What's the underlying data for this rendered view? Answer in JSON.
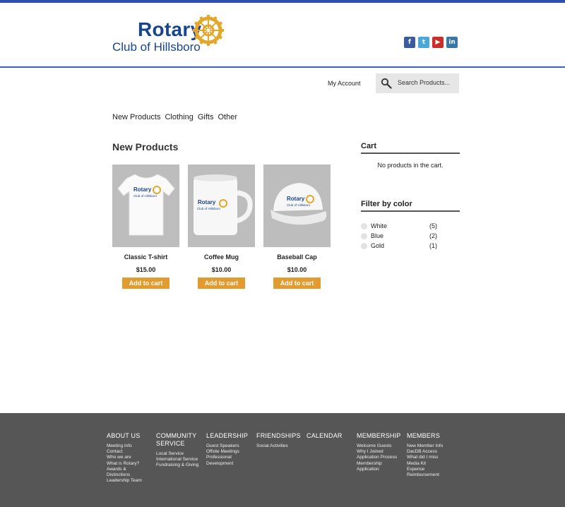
{
  "brand": {
    "logo_title": "Rotary",
    "logo_subtitle": "Club of Hillsboro",
    "wheel_color": "#e3a82b",
    "text_color": "#17458f"
  },
  "social": [
    {
      "name": "facebook",
      "glyph": "f"
    },
    {
      "name": "twitter",
      "glyph": "t"
    },
    {
      "name": "youtube",
      "glyph": "▶"
    },
    {
      "name": "linkedin",
      "glyph": "in"
    }
  ],
  "header": {
    "account_label": "My Account",
    "search_placeholder": "Search Products..."
  },
  "nav": [
    "New Products",
    "Clothing",
    "Gifts",
    "Other"
  ],
  "main": {
    "section_title": "New Products",
    "products": [
      {
        "name": "Classic T-shirt",
        "price": "$15.00",
        "button": "Add to cart",
        "image_text": "Rotary",
        "image_sub": "Club of Hillsboro"
      },
      {
        "name": "Coffee Mug",
        "price": "$10.00",
        "button": "Add to cart",
        "image_text": "Rotary",
        "image_sub": "Club of Hillsboro"
      },
      {
        "name": "Baseball Cap",
        "price": "$10.00",
        "button": "Add to cart",
        "image_text": "Rotary",
        "image_sub": "Club of Hillsboro"
      }
    ]
  },
  "sidebar": {
    "cart_title": "Cart",
    "cart_empty": "No products in the cart.",
    "filter_title": "Filter by color",
    "filters": [
      {
        "label": "White",
        "count": "(5)"
      },
      {
        "label": "Blue",
        "count": "(2)"
      },
      {
        "label": "Gold",
        "count": "(1)"
      }
    ]
  },
  "footer": {
    "columns": [
      {
        "title": "ABOUT US",
        "links": [
          "Meeting Info",
          "Contact",
          "Who we are",
          "What is Rotary?",
          "Awards &",
          "Distinctions",
          "Leadership Team"
        ]
      },
      {
        "title": "COMMUNITY SERVICE",
        "links": [
          "Local Service",
          "International Service",
          "Fundraising & Giving"
        ]
      },
      {
        "title": "LEADERSHIP",
        "links": [
          "Guest Speakers",
          "Offsite Meetings",
          "Professional",
          "Development"
        ]
      },
      {
        "title": "FRIENDSHIPS",
        "links": [
          "Social Activities"
        ]
      },
      {
        "title": "CALENDAR",
        "links": []
      },
      {
        "title": "MEMBERSHIP",
        "links": [
          "Welcome Guests",
          "Why I Joined",
          "Application Process",
          "Membership",
          "Application"
        ]
      },
      {
        "title": "MEMBERS",
        "links": [
          "New Member Info",
          "DacDB Access",
          "What did I miss",
          "Media Kit",
          "Expense",
          "Reimbursement"
        ]
      }
    ]
  },
  "colors": {
    "accent_blue": "#2f4eab",
    "button_orange": "#e19b2f",
    "footer_bg": "#565656"
  }
}
